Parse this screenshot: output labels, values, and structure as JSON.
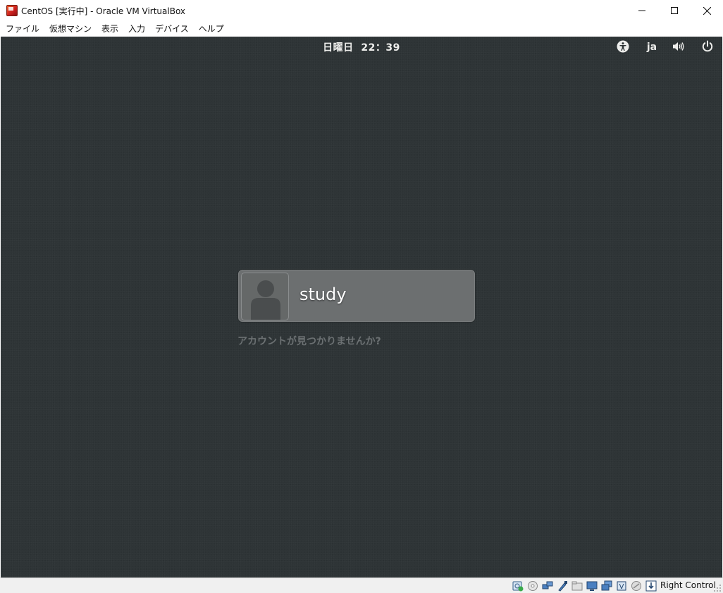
{
  "window": {
    "title": "CentOS [実行中] - Oracle VM VirtualBox"
  },
  "menubar": {
    "items": [
      "ファイル",
      "仮想マシン",
      "表示",
      "入力",
      "デバイス",
      "ヘルプ"
    ]
  },
  "guest": {
    "clock": "日曜日  22：39",
    "language": "ja",
    "user": {
      "name": "study"
    },
    "not_listed_label": "アカウントが見つかりませんか?"
  },
  "statusbar": {
    "host_key_label": "Right Control",
    "icons": [
      "hard-disk-icon",
      "optical-drive-icon",
      "network-icon",
      "usb-icon",
      "shared-folders-icon",
      "display-icon",
      "video-capture-icon",
      "cpu-virtualization-icon",
      "mouse-integration-icon",
      "keyboard-capture-icon"
    ]
  },
  "colors": {
    "guest_background": "#2e3436",
    "user_card": "#6c6f70",
    "topbar_text": "#eeeeec"
  }
}
